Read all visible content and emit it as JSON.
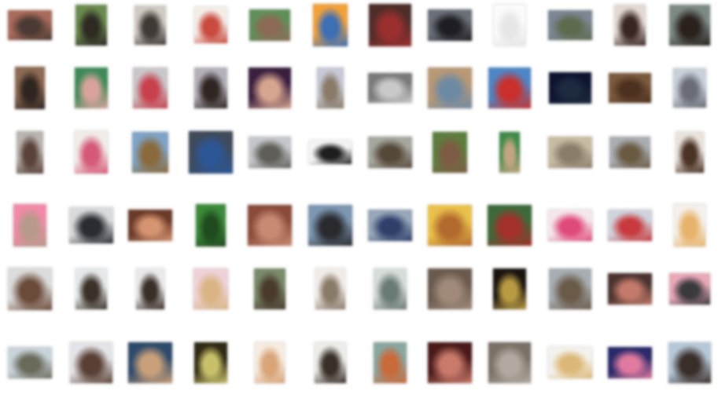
{
  "window": {
    "title": ""
  },
  "files": [
    {
      "name": "",
      "colors": [
        "#a86a5a",
        "#4a3a33"
      ]
    },
    {
      "name": "",
      "colors": [
        "#6b8a4f",
        "#2e2a22"
      ]
    },
    {
      "name": "",
      "colors": [
        "#cfcac4",
        "#3f3a35"
      ]
    },
    {
      "name": "",
      "colors": [
        "#f4ede8",
        "#c94a3e"
      ]
    },
    {
      "name": "",
      "colors": [
        "#5f8f59",
        "#8c6a55"
      ]
    },
    {
      "name": "",
      "colors": [
        "#f2a13a",
        "#3d6fb5"
      ]
    },
    {
      "name": "",
      "colors": [
        "#4e2e2a",
        "#9b2f2f"
      ]
    },
    {
      "name": "",
      "colors": [
        "#6a6f78",
        "#1e1e22"
      ]
    },
    {
      "name": "",
      "colors": [
        "#fbfbfb",
        "#e6e6e6"
      ]
    },
    {
      "name": "",
      "colors": [
        "#7c8694",
        "#5d6a4c"
      ]
    },
    {
      "name": "",
      "colors": [
        "#e4d9d2",
        "#3a2620"
      ]
    },
    {
      "name": "",
      "colors": [
        "#7d8a84",
        "#2a211d"
      ]
    },
    {
      "name": "",
      "colors": [
        "#8d6a53",
        "#2f2520"
      ]
    },
    {
      "name": "",
      "colors": [
        "#3f8a58",
        "#d8a39b"
      ]
    },
    {
      "name": "",
      "colors": [
        "#c9c6c9",
        "#c7404c"
      ]
    },
    {
      "name": "",
      "colors": [
        "#b4b0ba",
        "#2f2522"
      ]
    },
    {
      "name": "",
      "colors": [
        "#3a1f3f",
        "#d6a58f"
      ]
    },
    {
      "name": "",
      "colors": [
        "#c6c9d6",
        "#8a7a68"
      ]
    },
    {
      "name": "",
      "colors": [
        "#7a7a7a",
        "#c9c9c9"
      ]
    },
    {
      "name": "",
      "colors": [
        "#b99874",
        "#6e8aa3"
      ]
    },
    {
      "name": "",
      "colors": [
        "#4d86c6",
        "#c9302c"
      ]
    },
    {
      "name": "",
      "colors": [
        "#0e1430",
        "#1d2a3f"
      ]
    },
    {
      "name": "",
      "colors": [
        "#7a5a3c",
        "#4c3020"
      ]
    },
    {
      "name": "",
      "colors": [
        "#c8d0d8",
        "#6a6c78"
      ]
    },
    {
      "name": "",
      "colors": [
        "#b9b4b0",
        "#5a4238"
      ]
    },
    {
      "name": "",
      "colors": [
        "#f0ece8",
        "#d55a78"
      ]
    },
    {
      "name": "",
      "colors": [
        "#7fa3c6",
        "#8a6a3c"
      ]
    },
    {
      "name": "",
      "colors": [
        "#3f4a5a",
        "#2d5696"
      ]
    },
    {
      "name": "",
      "colors": [
        "#c4c7cb",
        "#5f5e58"
      ]
    },
    {
      "name": "",
      "colors": [
        "#f4f4f4",
        "#1e1e1e"
      ]
    },
    {
      "name": "",
      "colors": [
        "#a6a8a0",
        "#56493a"
      ]
    },
    {
      "name": "",
      "colors": [
        "#5d7e3f",
        "#7d5c43"
      ]
    },
    {
      "name": "",
      "colors": [
        "#3f8a4a",
        "#c2a580"
      ]
    },
    {
      "name": "",
      "colors": [
        "#c7bca3",
        "#8a7d6a"
      ]
    },
    {
      "name": "",
      "colors": [
        "#a9aeb2",
        "#6a5a42"
      ]
    },
    {
      "name": "",
      "colors": [
        "#e9e3dc",
        "#4a3224"
      ]
    },
    {
      "name": "",
      "colors": [
        "#f08aa8",
        "#b79a8a"
      ]
    },
    {
      "name": "",
      "colors": [
        "#d9dadc",
        "#2a2c32"
      ]
    },
    {
      "name": "",
      "colors": [
        "#6a3a2a",
        "#d69470"
      ]
    },
    {
      "name": "",
      "colors": [
        "#3c8a3a",
        "#1f4a1e"
      ]
    },
    {
      "name": "",
      "colors": [
        "#8a4a3a",
        "#c98a74"
      ]
    },
    {
      "name": "",
      "colors": [
        "#7d97b2",
        "#2a2a2e"
      ]
    },
    {
      "name": "",
      "colors": [
        "#98a6b8",
        "#2f3f6a"
      ]
    },
    {
      "name": "",
      "colors": [
        "#e9c14a",
        "#b36a2e"
      ]
    },
    {
      "name": "",
      "colors": [
        "#3c6a3a",
        "#a3302a"
      ]
    },
    {
      "name": "",
      "colors": [
        "#f4e6ec",
        "#e04a7a"
      ]
    },
    {
      "name": "",
      "colors": [
        "#cfd3dc",
        "#c83a3e"
      ]
    },
    {
      "name": "",
      "colors": [
        "#f4f0ea",
        "#e7b36a"
      ]
    },
    {
      "name": "",
      "colors": [
        "#dcdcdc",
        "#6a4a38"
      ]
    },
    {
      "name": "",
      "colors": [
        "#e6e8ea",
        "#3a3128"
      ]
    },
    {
      "name": "",
      "colors": [
        "#eaeaea",
        "#3a2e28"
      ]
    },
    {
      "name": "",
      "colors": [
        "#eed2d8",
        "#d9b484"
      ]
    },
    {
      "name": "",
      "colors": [
        "#7a8a6a",
        "#4a3a2e"
      ]
    },
    {
      "name": "",
      "colors": [
        "#f0ece8",
        "#8a7a68"
      ]
    },
    {
      "name": "",
      "colors": [
        "#d6dcd6",
        "#6a7a76"
      ]
    },
    {
      "name": "",
      "colors": [
        "#6a5a4e",
        "#a08a7a"
      ]
    },
    {
      "name": "",
      "colors": [
        "#1a1410",
        "#b89a42"
      ]
    },
    {
      "name": "",
      "colors": [
        "#a6aeb2",
        "#6a5a48"
      ]
    },
    {
      "name": "",
      "colors": [
        "#4a3430",
        "#c47a6a"
      ]
    },
    {
      "name": "",
      "colors": [
        "#e9a8b8",
        "#3a3a3e"
      ]
    },
    {
      "name": "",
      "colors": [
        "#c8d3da",
        "#6a6a5a"
      ]
    },
    {
      "name": "",
      "colors": [
        "#e4e4e8",
        "#5a4034"
      ]
    },
    {
      "name": "",
      "colors": [
        "#2e4a6a",
        "#c9a07a"
      ]
    },
    {
      "name": "",
      "colors": [
        "#2f2a14",
        "#c9c16a"
      ]
    },
    {
      "name": "",
      "colors": [
        "#f6ece0",
        "#d8a478"
      ]
    },
    {
      "name": "",
      "colors": [
        "#ecece8",
        "#3a2e28"
      ]
    },
    {
      "name": "",
      "colors": [
        "#8aa6a0",
        "#c96a3a"
      ]
    },
    {
      "name": "",
      "colors": [
        "#4a1a1a",
        "#c97a6a"
      ]
    },
    {
      "name": "",
      "colors": [
        "#7a7066",
        "#b2aaa0"
      ]
    },
    {
      "name": "",
      "colors": [
        "#f4f2ee",
        "#dcb878"
      ]
    },
    {
      "name": "",
      "colors": [
        "#2a2a6a",
        "#e07aa0"
      ]
    },
    {
      "name": "",
      "colors": [
        "#b6c8d8",
        "#3a2e2a"
      ]
    }
  ]
}
